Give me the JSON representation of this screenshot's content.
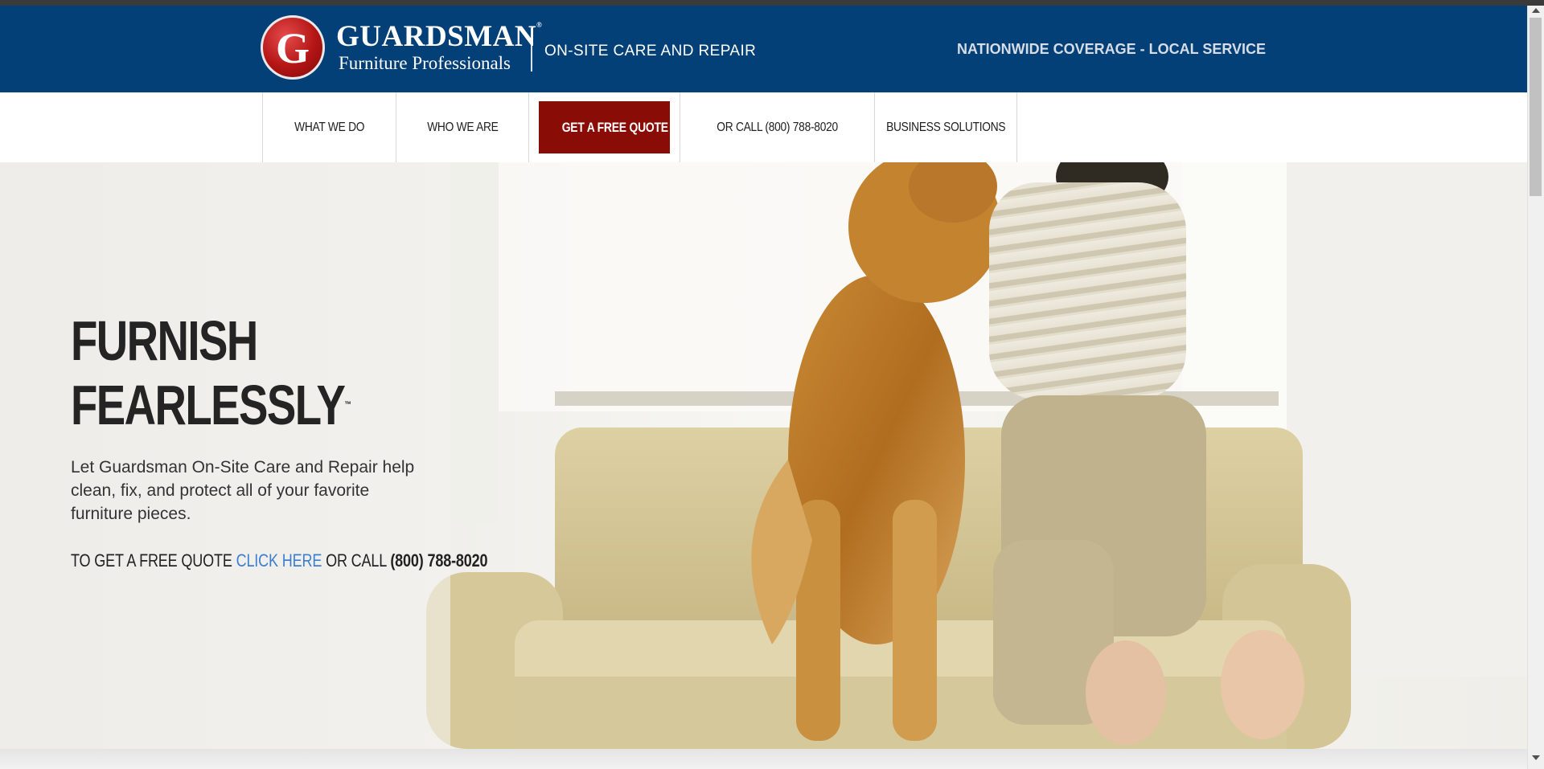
{
  "header": {
    "logo_letter": "G",
    "brand_name": "GUARDSMAN",
    "brand_mark": "®",
    "brand_sub": "Furniture Professionals",
    "service_label": "ON-SITE CARE AND REPAIR",
    "coverage_label": "NATIONWIDE COVERAGE - LOCAL SERVICE",
    "bg_color": "#034077"
  },
  "nav": {
    "items": [
      {
        "label": "WHAT WE DO"
      },
      {
        "label": "WHO WE ARE"
      },
      {
        "label": "GET A FREE QUOTE"
      },
      {
        "label": "OR CALL (800) 788-8020"
      },
      {
        "label": "BUSINESS SOLUTIONS"
      }
    ],
    "quote_color": "#8a0c06"
  },
  "hero": {
    "title_line1": "FURNISH",
    "title_line2": "FEARLESSLY",
    "title_mark": "™",
    "body": "Let Guardsman On-Site Care and Repair help clean, fix, and protect all of your favorite furniture pieces.",
    "cta_prefix": "TO GET A FREE QUOTE",
    "cta_link": "CLICK HERE",
    "cta_middle": "OR CALL",
    "cta_phone": "(800) 788-8020",
    "link_color": "#3c7fd0",
    "image": "photo of a golden retriever and a child looking out a window from a beige sofa"
  }
}
